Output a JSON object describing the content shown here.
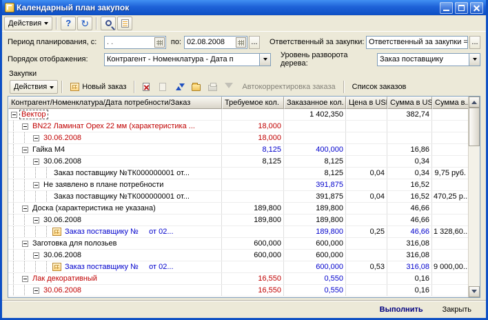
{
  "window": {
    "title": "Календарный план закупок"
  },
  "main_toolbar": {
    "actions": "Действия",
    "help": "?",
    "refresh_glyph": "↻",
    "icons": [
      "help-icon",
      "refresh-icon",
      "find-icon",
      "report-icon"
    ]
  },
  "filters": {
    "period_label": "Период планирования, с:",
    "period_from": " .  .",
    "to_label": "по:",
    "period_to": "02.08.2008",
    "period_more": "...",
    "responsible_label": "Ответственный за закупки:",
    "responsible_value": "Ответственный за закупки = \"У...",
    "responsible_more": "...",
    "order_label": "Порядок отображения:",
    "order_value": "Контрагент - Номенклатура - Дата п",
    "depth_label": "Уровень разворота дерева:",
    "depth_value": "Заказ поставщику"
  },
  "section_title": "Закупки",
  "cmdbar": {
    "actions": "Действия",
    "new_order": "Новый заказ",
    "autocorrect": "Автокорректировка заказа",
    "orders_list": "Список заказов",
    "icons": [
      "new-order-icon",
      "close-order-icon",
      "move-order-icon",
      "sort-icon",
      "open-document-icon",
      "print-icon",
      "filter-icon"
    ]
  },
  "table": {
    "columns": [
      "Контрагент/Номенклатура/Дата потребности/Заказ",
      "Требуемое кол.",
      "Заказанное кол.",
      "Цена в USD",
      "Сумма в USD",
      "Сумма в..."
    ],
    "rows": [
      {
        "level": 0,
        "node": true,
        "color": "red",
        "selected": true,
        "text": "Вектор",
        "values": [
          {
            "t": ""
          },
          {
            "t": "1 402,350"
          },
          {
            "t": ""
          },
          {
            "t": "382,74"
          },
          {
            "t": ""
          }
        ]
      },
      {
        "level": 1,
        "node": true,
        "color": "red",
        "text": "BN22 Ламинат Орех 22 мм (характеристика ...",
        "values": [
          {
            "t": "18,000",
            "c": "red"
          },
          {
            "t": ""
          },
          {
            "t": ""
          },
          {
            "t": ""
          },
          {
            "t": ""
          }
        ]
      },
      {
        "level": 2,
        "node": true,
        "color": "red",
        "text": "30.06.2008",
        "values": [
          {
            "t": "18,000",
            "c": "red"
          },
          {
            "t": ""
          },
          {
            "t": ""
          },
          {
            "t": ""
          },
          {
            "t": ""
          }
        ]
      },
      {
        "level": 1,
        "node": true,
        "text": "Гайка М4",
        "values": [
          {
            "t": "8,125",
            "c": "blue"
          },
          {
            "t": "400,000",
            "c": "blue"
          },
          {
            "t": ""
          },
          {
            "t": "16,86"
          },
          {
            "t": ""
          }
        ]
      },
      {
        "level": 2,
        "node": true,
        "text": "30.06.2008",
        "values": [
          {
            "t": "8,125"
          },
          {
            "t": "8,125"
          },
          {
            "t": ""
          },
          {
            "t": "0,34"
          },
          {
            "t": ""
          }
        ]
      },
      {
        "level": 3,
        "node": false,
        "text": "Заказ поставщику №ТК000000001 от...",
        "values": [
          {
            "t": ""
          },
          {
            "t": "8,125"
          },
          {
            "t": "0,04"
          },
          {
            "t": "0,34"
          },
          {
            "t": "9,75 руб."
          }
        ]
      },
      {
        "level": 2,
        "node": true,
        "text": "Не заявлено в плане потребности",
        "values": [
          {
            "t": ""
          },
          {
            "t": "391,875",
            "c": "blue"
          },
          {
            "t": ""
          },
          {
            "t": "16,52"
          },
          {
            "t": ""
          }
        ]
      },
      {
        "level": 3,
        "node": false,
        "text": "Заказ поставщику №ТК000000001 от...",
        "values": [
          {
            "t": ""
          },
          {
            "t": "391,875"
          },
          {
            "t": "0,04"
          },
          {
            "t": "16,52"
          },
          {
            "t": "470,25 р..."
          }
        ]
      },
      {
        "level": 1,
        "node": true,
        "text": "Доска (характеристика не указана)",
        "values": [
          {
            "t": "189,800"
          },
          {
            "t": "189,800"
          },
          {
            "t": ""
          },
          {
            "t": "46,66"
          },
          {
            "t": ""
          }
        ]
      },
      {
        "level": 2,
        "node": true,
        "text": "30.06.2008",
        "values": [
          {
            "t": "189,800"
          },
          {
            "t": "189,800"
          },
          {
            "t": ""
          },
          {
            "t": "46,66"
          },
          {
            "t": ""
          }
        ]
      },
      {
        "level": 3,
        "node": false,
        "icon": "doc",
        "color": "blue",
        "text": "Заказ поставщику №     от 02...",
        "values": [
          {
            "t": ""
          },
          {
            "t": "189,800",
            "c": "blue"
          },
          {
            "t": "0,25"
          },
          {
            "t": "46,66",
            "c": "blue"
          },
          {
            "t": "1 328,60..."
          }
        ]
      },
      {
        "level": 1,
        "node": true,
        "text": "Заготовка для полозьев",
        "values": [
          {
            "t": "600,000"
          },
          {
            "t": "600,000"
          },
          {
            "t": ""
          },
          {
            "t": "316,08"
          },
          {
            "t": ""
          }
        ]
      },
      {
        "level": 2,
        "node": true,
        "text": "30.06.2008",
        "values": [
          {
            "t": "600,000"
          },
          {
            "t": "600,000"
          },
          {
            "t": ""
          },
          {
            "t": "316,08"
          },
          {
            "t": ""
          }
        ]
      },
      {
        "level": 3,
        "node": false,
        "icon": "doc",
        "color": "blue",
        "text": "Заказ поставщику №     от 02...",
        "values": [
          {
            "t": ""
          },
          {
            "t": "600,000",
            "c": "blue"
          },
          {
            "t": "0,53"
          },
          {
            "t": "316,08",
            "c": "blue"
          },
          {
            "t": "9 000,00..."
          }
        ]
      },
      {
        "level": 1,
        "node": true,
        "color": "red",
        "text": "Лак декоративный",
        "values": [
          {
            "t": "16,550",
            "c": "red"
          },
          {
            "t": "0,550",
            "c": "blue"
          },
          {
            "t": ""
          },
          {
            "t": "0,16"
          },
          {
            "t": ""
          }
        ]
      },
      {
        "level": 2,
        "node": true,
        "color": "red",
        "text": "30.06.2008",
        "values": [
          {
            "t": "16,550",
            "c": "red"
          },
          {
            "t": "0,550",
            "c": "blue"
          },
          {
            "t": ""
          },
          {
            "t": "0,16"
          },
          {
            "t": ""
          }
        ]
      }
    ]
  },
  "footer": {
    "execute": "Выполнить",
    "close": "Закрыть"
  },
  "colors": {
    "title_blue": "#1E62D8",
    "red_text": "#C00000",
    "blue_text": "#0000CC",
    "background": "#ECE9D8"
  }
}
